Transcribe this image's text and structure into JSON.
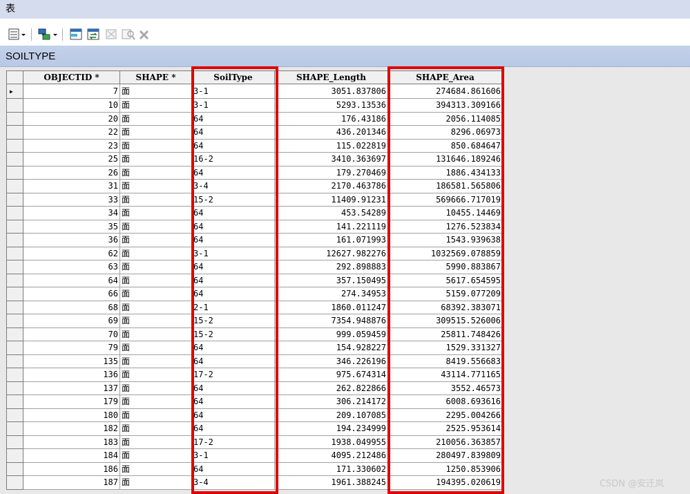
{
  "window": {
    "title": "表"
  },
  "toolbar": {
    "icons": [
      "table-options-icon",
      "related-tables-icon",
      "select-by-attributes-icon",
      "switch-selection-icon",
      "clear-selection-icon",
      "zoom-to-selected-icon",
      "delete-selected-icon"
    ]
  },
  "tab": {
    "label": "SOILTYPE"
  },
  "table": {
    "columns": [
      "OBJECTID *",
      "SHAPE *",
      "SoilType",
      "SHAPE_Length",
      "SHAPE_Area"
    ],
    "rows": [
      [
        "7",
        "面",
        "3-1",
        "3051.837806",
        "274684.861606"
      ],
      [
        "10",
        "面",
        "3-1",
        "5293.13536",
        "394313.309166"
      ],
      [
        "20",
        "面",
        "64",
        "176.43186",
        "2056.114085"
      ],
      [
        "22",
        "面",
        "64",
        "436.201346",
        "8296.06973"
      ],
      [
        "23",
        "面",
        "64",
        "115.022819",
        "850.684647"
      ],
      [
        "25",
        "面",
        "16-2",
        "3410.363697",
        "131646.189246"
      ],
      [
        "26",
        "面",
        "64",
        "179.270469",
        "1886.434133"
      ],
      [
        "31",
        "面",
        "3-4",
        "2170.463786",
        "186581.565806"
      ],
      [
        "33",
        "面",
        "15-2",
        "11409.91231",
        "569666.717019"
      ],
      [
        "34",
        "面",
        "64",
        "453.54289",
        "10455.14469"
      ],
      [
        "35",
        "面",
        "64",
        "141.221119",
        "1276.523834"
      ],
      [
        "36",
        "面",
        "64",
        "161.071993",
        "1543.939638"
      ],
      [
        "62",
        "面",
        "3-1",
        "12627.982276",
        "1032569.078859"
      ],
      [
        "63",
        "面",
        "64",
        "292.898883",
        "5990.883867"
      ],
      [
        "64",
        "面",
        "64",
        "357.150495",
        "5617.654595"
      ],
      [
        "66",
        "面",
        "64",
        "274.34953",
        "5159.077209"
      ],
      [
        "68",
        "面",
        "2-1",
        "1860.011247",
        "68392.383071"
      ],
      [
        "69",
        "面",
        "15-2",
        "7354.948876",
        "309515.526006"
      ],
      [
        "70",
        "面",
        "15-2",
        "999.059459",
        "25811.748426"
      ],
      [
        "79",
        "面",
        "64",
        "154.928227",
        "1529.331327"
      ],
      [
        "135",
        "面",
        "64",
        "346.226196",
        "8419.556683"
      ],
      [
        "136",
        "面",
        "17-2",
        "975.674314",
        "43114.771165"
      ],
      [
        "137",
        "面",
        "64",
        "262.822866",
        "3552.46573"
      ],
      [
        "179",
        "面",
        "64",
        "306.214172",
        "6008.693616"
      ],
      [
        "180",
        "面",
        "64",
        "209.107085",
        "2295.004266"
      ],
      [
        "182",
        "面",
        "64",
        "194.234999",
        "2525.953614"
      ],
      [
        "183",
        "面",
        "17-2",
        "1938.049955",
        "210056.363857"
      ],
      [
        "184",
        "面",
        "3-1",
        "4095.212486",
        "280497.839809"
      ],
      [
        "186",
        "面",
        "64",
        "171.330602",
        "1250.853906"
      ],
      [
        "187",
        "面",
        "3-4",
        "1961.388245",
        "194395.020619"
      ]
    ]
  },
  "highlight_color": "#e00000",
  "watermark": "CSDN @安迁岚"
}
